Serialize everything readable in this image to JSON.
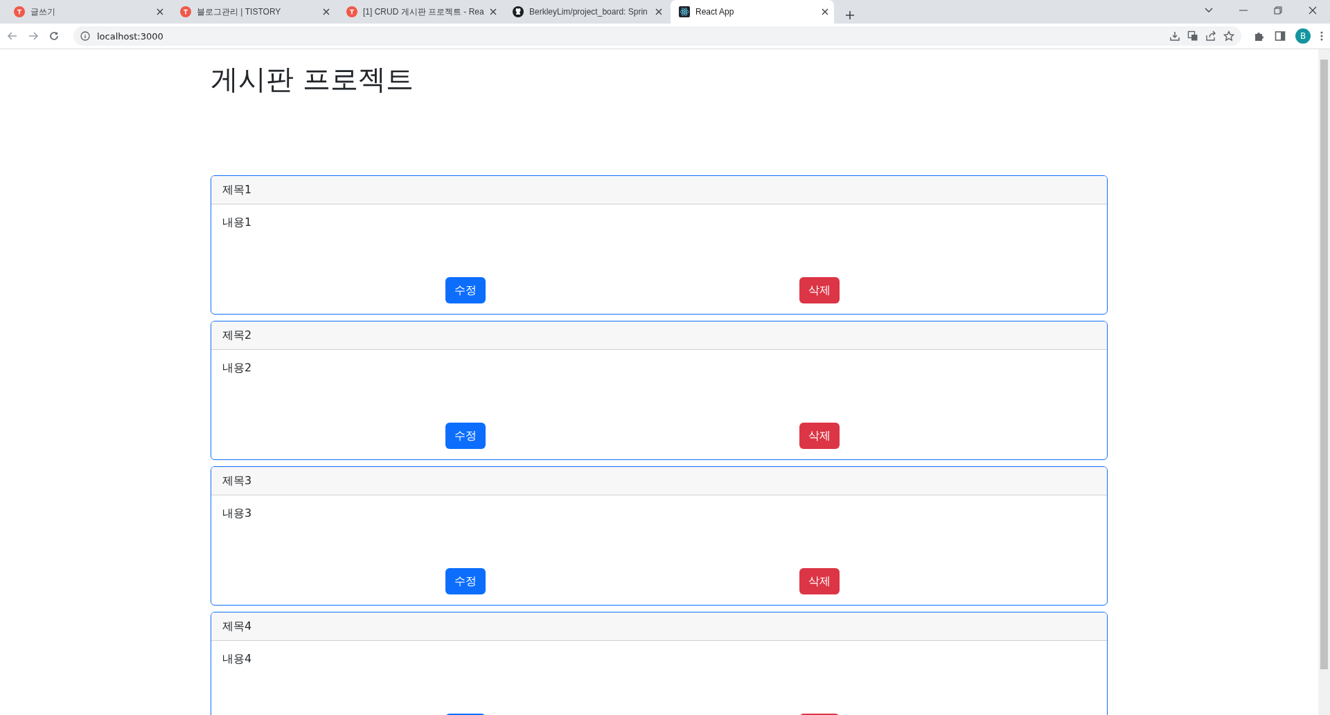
{
  "browser": {
    "tabs": [
      {
        "title": "글쓰기",
        "kind": "tistory",
        "selected": false
      },
      {
        "title": "블로그관리 | TISTORY",
        "kind": "tistory",
        "selected": false
      },
      {
        "title": "[1] CRUD 게시판 프로젝트 - Rea",
        "kind": "tistory",
        "selected": false
      },
      {
        "title": "BerkleyLim/project_board: Sprin",
        "kind": "github",
        "selected": false
      },
      {
        "title": "React App",
        "kind": "react",
        "selected": true
      }
    ],
    "address": "localhost:3000",
    "profile": "B"
  },
  "page": {
    "title": "게시판 프로젝트",
    "posts": [
      {
        "title": "제목1",
        "content": "내용1",
        "edit": "수정",
        "delete": "삭제"
      },
      {
        "title": "제목2",
        "content": "내용2",
        "edit": "수정",
        "delete": "삭제"
      },
      {
        "title": "제목3",
        "content": "내용3",
        "edit": "수정",
        "delete": "삭제"
      },
      {
        "title": "제목4",
        "content": "내용4"
      }
    ]
  }
}
